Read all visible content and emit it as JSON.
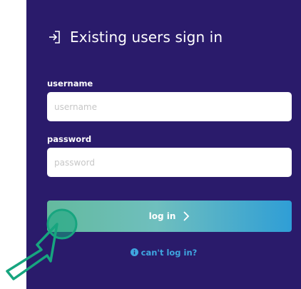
{
  "signin": {
    "heading": "Existing users sign in",
    "username_label": "username",
    "username_placeholder": "username",
    "password_label": "password",
    "password_placeholder": "password",
    "login_label": "log in",
    "help_label": "can't log in?"
  },
  "icons": {
    "heading": "login-arrow-icon",
    "button": "chevron-right-icon",
    "help": "info-circle-icon",
    "cursor": "pointer-hand-cursor"
  },
  "colors": {
    "panel_background": "#2a1b6b",
    "button_gradient_start": "#64ba9e",
    "button_gradient_end": "#2f9ed6",
    "link": "#3fa6e0",
    "cursor_highlight": "#17a57f"
  }
}
